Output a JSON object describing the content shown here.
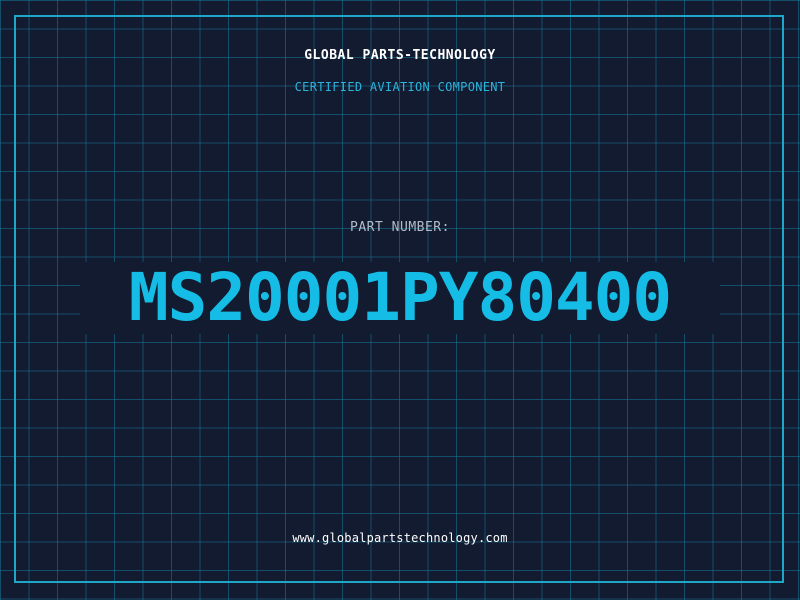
{
  "header": {
    "company_name": "GLOBAL PARTS-TECHNOLOGY",
    "subtitle": "CERTIFIED AVIATION COMPONENT"
  },
  "part": {
    "label": "PART NUMBER:",
    "number": "MS20001PY80400"
  },
  "footer": {
    "website": "www.globalpartstechnology.com"
  },
  "colors": {
    "background": "#121b30",
    "grid": "#16788f",
    "accent": "#15bde6",
    "border": "#1ea7c9",
    "label": "#b4bcc8",
    "text": "#ffffff"
  }
}
